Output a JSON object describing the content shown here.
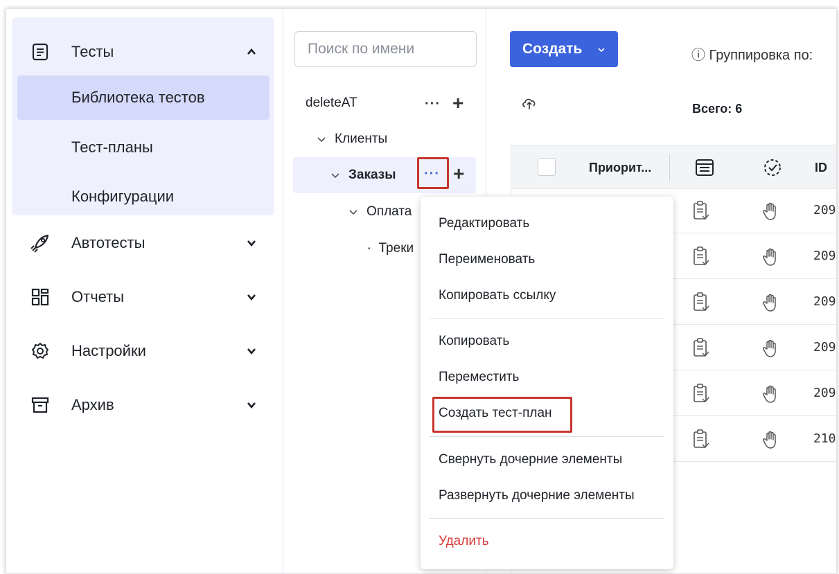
{
  "sidebar": {
    "tests": {
      "label": "Тесты",
      "icon": "list-document-icon",
      "expanded": true
    },
    "test_items": [
      "Библиотека тестов",
      "Тест-планы",
      "Конфигурации"
    ],
    "active_item": "Библиотека тестов",
    "sections": [
      {
        "label": "Автотесты",
        "icon": "rocket-icon"
      },
      {
        "label": "Отчеты",
        "icon": "grid-icon"
      },
      {
        "label": "Настройки",
        "icon": "gear-icon"
      },
      {
        "label": "Архив",
        "icon": "archive-icon"
      }
    ]
  },
  "tree": {
    "search_placeholder": "Поиск по имени",
    "nodes": [
      "deleteAT",
      "Клиенты",
      "Заказы",
      "Оплата",
      "Треки"
    ],
    "selected": "Заказы",
    "more_label": "···",
    "add_label": "+"
  },
  "main": {
    "create_button": "Создать",
    "grouping_text": "ⓘ Группировка по:",
    "total_text": "Всего: 6",
    "columns": {
      "priority": "Приорит...",
      "id": "ID"
    },
    "row_ids": [
      "209",
      "209",
      "209",
      "209",
      "209",
      "210"
    ]
  },
  "menu": {
    "items": [
      "Редактировать",
      "Переименовать",
      "Копировать ссылку",
      "Копировать",
      "Переместить",
      "Создать тест-план",
      "Свернуть дочерние элементы",
      "Развернуть дочерние элементы",
      "Удалить"
    ],
    "highlighted": "Создать тест-план"
  },
  "colors": {
    "accent": "#3b63dd",
    "active_bg": "#d5dafb",
    "group_bg": "#eef0fd",
    "highlight_border": "#c8352e",
    "danger": "#d93a3a"
  }
}
